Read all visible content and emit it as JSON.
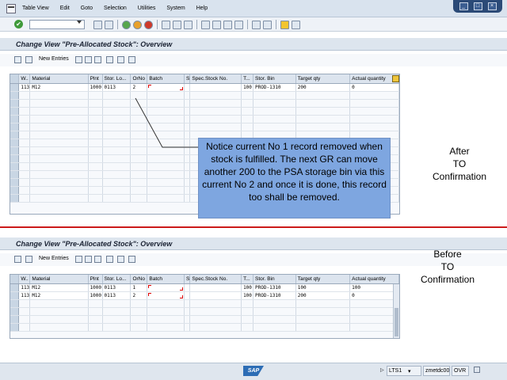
{
  "menu": {
    "items": [
      "Table View",
      "Edit",
      "Goto",
      "Selection",
      "Utilities",
      "System",
      "Help"
    ]
  },
  "panels": [
    {
      "title": "Change View \"Pre-Allocated Stock\": Overview",
      "new_entries_label": "New Entries",
      "columns": [
        "W..",
        "Material",
        "Plnt",
        "Stor. Lo...",
        "OrNo",
        "Batch",
        "S",
        "Spec.Stock No.",
        "T...",
        "Stor. Bin",
        "Target qty",
        "Actual quantity"
      ],
      "rows": [
        [
          "113",
          "M12",
          "1000",
          "0113",
          "2",
          "",
          "",
          "",
          "100",
          "PROD-1310",
          "200",
          "0"
        ]
      ]
    },
    {
      "title": "Change View \"Pre-Allocated Stock\": Overview",
      "new_entries_label": "New Entries",
      "columns": [
        "W..",
        "Material",
        "Plnt",
        "Stor. Lo...",
        "OrNo",
        "Batch",
        "S",
        "Spec.Stock No.",
        "T...",
        "Stor. Bin",
        "Target qty",
        "Actual quantity"
      ],
      "rows": [
        [
          "113",
          "M12",
          "1000",
          "0113",
          "1",
          "",
          "",
          "",
          "100",
          "PROD-1310",
          "100",
          "100"
        ],
        [
          "113",
          "M12",
          "1000",
          "0113",
          "2",
          "",
          "",
          "",
          "100",
          "PROD-1310",
          "200",
          "0"
        ]
      ]
    }
  ],
  "callout_text": "Notice current No 1 record removed when stock is fulfilled. The next GR  can move another 200 to the PSA storage bin via this current No 2 and once it is done, this record too shall be removed.",
  "label_after": "After\nTO\nConfirmation",
  "label_before": "Before\nTO\nConfirmation",
  "status": {
    "logo": "SAP",
    "system": "LTS1",
    "server": "zmetdc00",
    "mode": "OVR"
  },
  "colors": {
    "divider": "#cc1a1a",
    "callout": "#7ea6e0",
    "menubar": "#d9e3ee"
  }
}
